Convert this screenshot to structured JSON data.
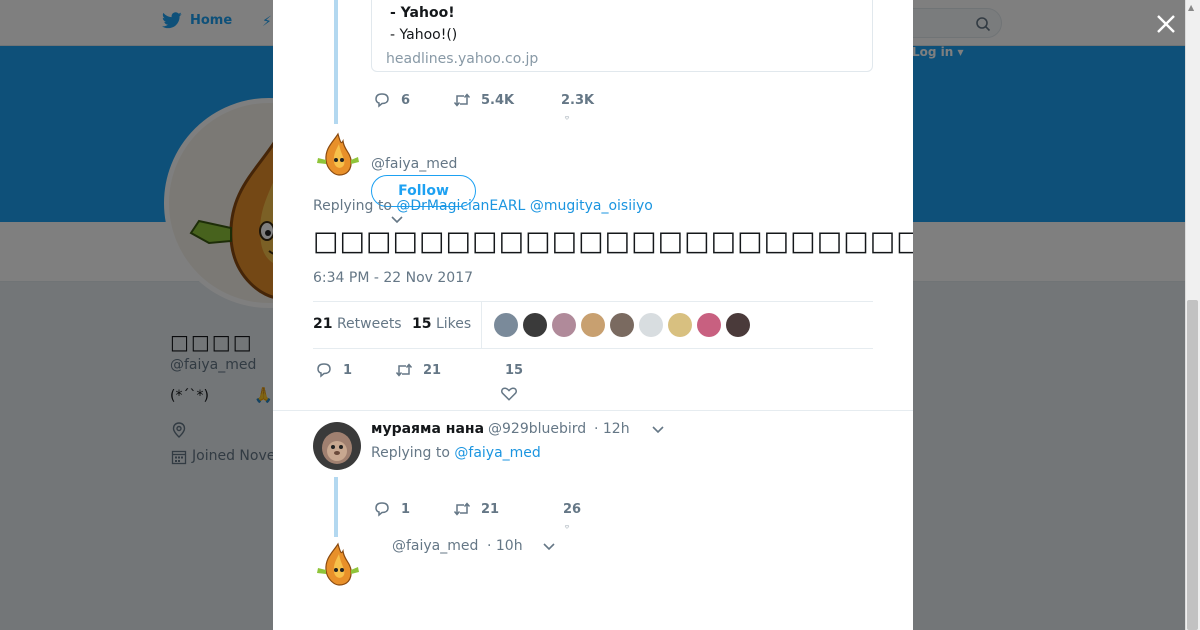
{
  "nav": {
    "home_label": "Home",
    "login_label": "Log in ▾"
  },
  "profile": {
    "name": "□□□□",
    "handle": "@faiya_med",
    "bio": "(*´ˋ*)",
    "joined": "Joined Nove"
  },
  "card": {
    "title": "- Yahoo!",
    "description": "- Yahoo!()",
    "domain": "headlines.yahoo.co.jp"
  },
  "quoted_actions": {
    "replies": "6",
    "retweets": "5.4K",
    "likes": "2.3K"
  },
  "tweet": {
    "handle": "@faiya_med",
    "follow_label": "Follow",
    "replying_prefix": "Replying to ",
    "mentions": [
      "@DrMagicianEARL",
      "@mugitya_oisiiyo"
    ],
    "text": "□□□□□□□□□□□□□□□□□□□□□□□□□□□□□□□□□□□□□□□□",
    "timestamp": "6:34 PM - 22 Nov 2017",
    "retweets_count": "21",
    "retweets_label": "Retweets",
    "likes_count": "15",
    "likes_label": "Likes",
    "liker_colors": [
      "#7a8a9a",
      "#3a3a3a",
      "#b08a9a",
      "#c8a070",
      "#7a6a60",
      "#d8dde0",
      "#d8c080",
      "#c86080",
      "#4a3a3a"
    ],
    "actions": {
      "replies": "1",
      "retweets": "21",
      "likes": "15"
    }
  },
  "reply": {
    "name": "мураяма нана",
    "handle": "@929bluebird",
    "time": "· 12h",
    "replying_prefix": "Replying to ",
    "mention": "@faiya_med",
    "actions": {
      "replies": "1",
      "retweets": "21",
      "likes": "26"
    }
  },
  "next_tweet": {
    "handle": "@faiya_med",
    "time": "· 10h"
  },
  "colors": {
    "accent": "#1da1f2",
    "thread_line": "#b3d8f0",
    "muted": "#657786"
  }
}
